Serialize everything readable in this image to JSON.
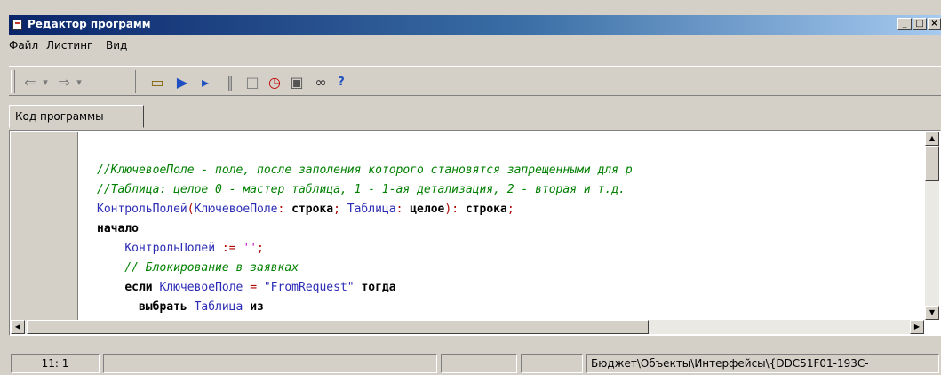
{
  "window": {
    "title": "Редактор программ"
  },
  "menu": [
    "Файл",
    "Листинг",
    "Вид"
  ],
  "toolbar": {
    "buttons": [
      {
        "name": "back-arrow-icon",
        "glyph": "⇐"
      },
      {
        "name": "back-dropdown-icon",
        "glyph": "▾"
      },
      {
        "name": "forward-arrow-icon",
        "glyph": "⇒"
      },
      {
        "name": "forward-dropdown-icon",
        "glyph": "▾"
      },
      {
        "name": "load-binary-icon",
        "glyph": "▭"
      },
      {
        "name": "run-icon",
        "glyph": "▶"
      },
      {
        "name": "step-icon",
        "glyph": "▸"
      },
      {
        "name": "pause-icon",
        "glyph": "‖"
      },
      {
        "name": "stop-icon",
        "glyph": "□"
      },
      {
        "name": "clock-icon",
        "glyph": "◷"
      },
      {
        "name": "save-icon",
        "glyph": "▣"
      },
      {
        "name": "glasses-icon",
        "glyph": "∞"
      },
      {
        "name": "help-icon",
        "glyph": "?"
      }
    ]
  },
  "tabs": [
    "Код программы"
  ],
  "code": [
    "//КлючевоеПоле - поле, после заполения которого становятся запрещенными для р",
    "//Таблица: целое 0 - мастер таблица, 1 - 1-ая детализация, 2 - вторая и т.д.",
    "КонтрольПолей(КлючевоеПоле: строка; Таблица: целое): строка;",
    "начало",
    "    КонтрольПолей := '';",
    "    // Блокирование в заявках",
    "    если КлючевоеПоле = \"FromRequest\" тогда",
    "      выбрать Таблица из"
  ],
  "status": {
    "position": "11: 1",
    "path": "Бюджет\\Объекты\\Интерфейсы\\{DDC51F01-193C-"
  }
}
